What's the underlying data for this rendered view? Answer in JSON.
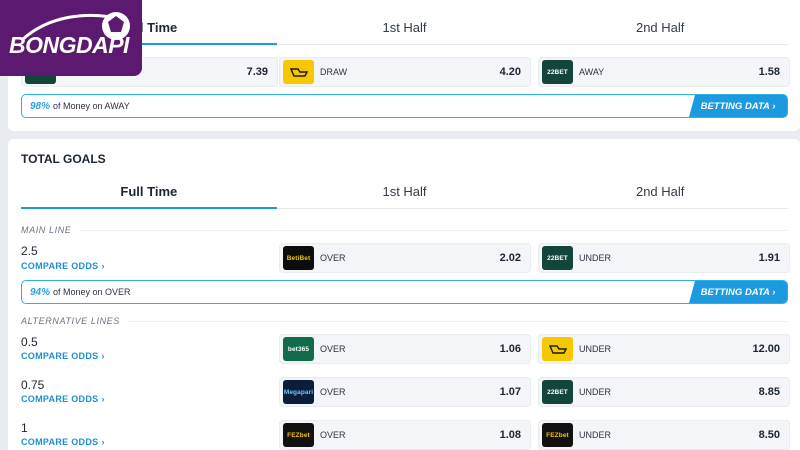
{
  "brand": {
    "name": "BONGDAPI"
  },
  "card1": {
    "tabs": [
      {
        "label": "Full Time"
      },
      {
        "label": "1st Half"
      },
      {
        "label": "2nd Half"
      }
    ],
    "odds": [
      {
        "label": "",
        "value": "7.39",
        "bookmaker": ""
      },
      {
        "label": "DRAW",
        "value": "4.20",
        "bookmaker": ""
      },
      {
        "label": "AWAY",
        "value": "1.58",
        "bookmaker": "22BET"
      }
    ],
    "money": {
      "pct": "98%",
      "text": "of Money on AWAY",
      "button": "BETTING DATA ›"
    }
  },
  "card2": {
    "title": "TOTAL GOALS",
    "tabs": [
      {
        "label": "Full Time"
      },
      {
        "label": "1st Half"
      },
      {
        "label": "2nd Half"
      }
    ],
    "main_line_heading": "MAIN LINE",
    "main": {
      "line": "2.5",
      "compare": "COMPARE ODDS",
      "over": {
        "label": "OVER",
        "value": "2.02",
        "bookmaker": "BetiBet"
      },
      "under": {
        "label": "UNDER",
        "value": "1.91",
        "bookmaker": "22BET"
      }
    },
    "money": {
      "pct": "94%",
      "text": "of Money on OVER",
      "button": "BETTING DATA ›"
    },
    "alt_heading": "ALTERNATIVE LINES",
    "alt_lines": [
      {
        "line": "0.5",
        "compare": "COMPARE ODDS",
        "over": {
          "label": "OVER",
          "value": "1.06",
          "bookmaker": "bet365"
        },
        "under": {
          "label": "UNDER",
          "value": "12.00",
          "bookmaker": ""
        }
      },
      {
        "line": "0.75",
        "compare": "COMPARE ODDS",
        "over": {
          "label": "OVER",
          "value": "1.07",
          "bookmaker": "Megapari"
        },
        "under": {
          "label": "UNDER",
          "value": "8.85",
          "bookmaker": "22BET"
        }
      },
      {
        "line": "1",
        "compare": "COMPARE ODDS",
        "over": {
          "label": "OVER",
          "value": "1.08",
          "bookmaker": "FEZbet"
        },
        "under": {
          "label": "UNDER",
          "value": "8.50",
          "bookmaker": "FEZbet"
        }
      }
    ]
  }
}
